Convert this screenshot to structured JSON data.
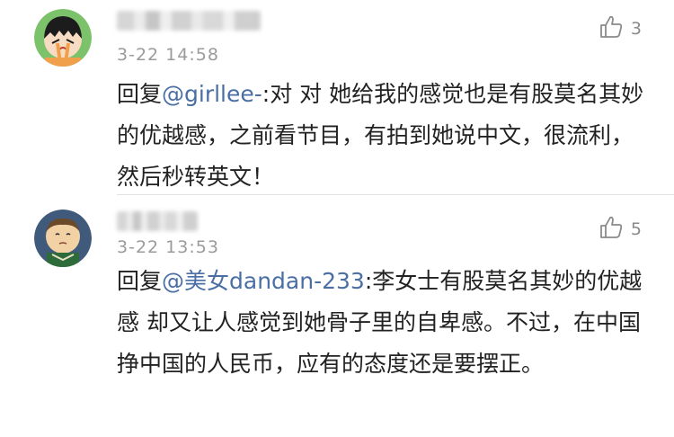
{
  "comments": [
    {
      "time": "3-22 14:58",
      "likes": "3",
      "reply_prefix": "回复",
      "mention": "@girllee-",
      "text": ":对 对 她给我的感觉也是有股莫名其妙的优越感，之前看节目，有拍到她说中文，很流利，然后秒转英文！",
      "avatar": "cartoon-girl-avatar"
    },
    {
      "time": "3-22 13:53",
      "likes": "5",
      "reply_prefix": "回复",
      "mention": "@美女dandan-233",
      "text": ":李女士有股莫名其妙的优越感 却又让人感觉到她骨子里的自卑感。不过，在中国挣中国的人民币，应有的态度还是要摆正。",
      "avatar": "cartoon-man-avatar"
    }
  ],
  "icons": {
    "like": "thumbs-up-icon"
  },
  "colors": {
    "mention": "#4a6fa5",
    "time": "#9b9b9b",
    "text": "#222222"
  }
}
